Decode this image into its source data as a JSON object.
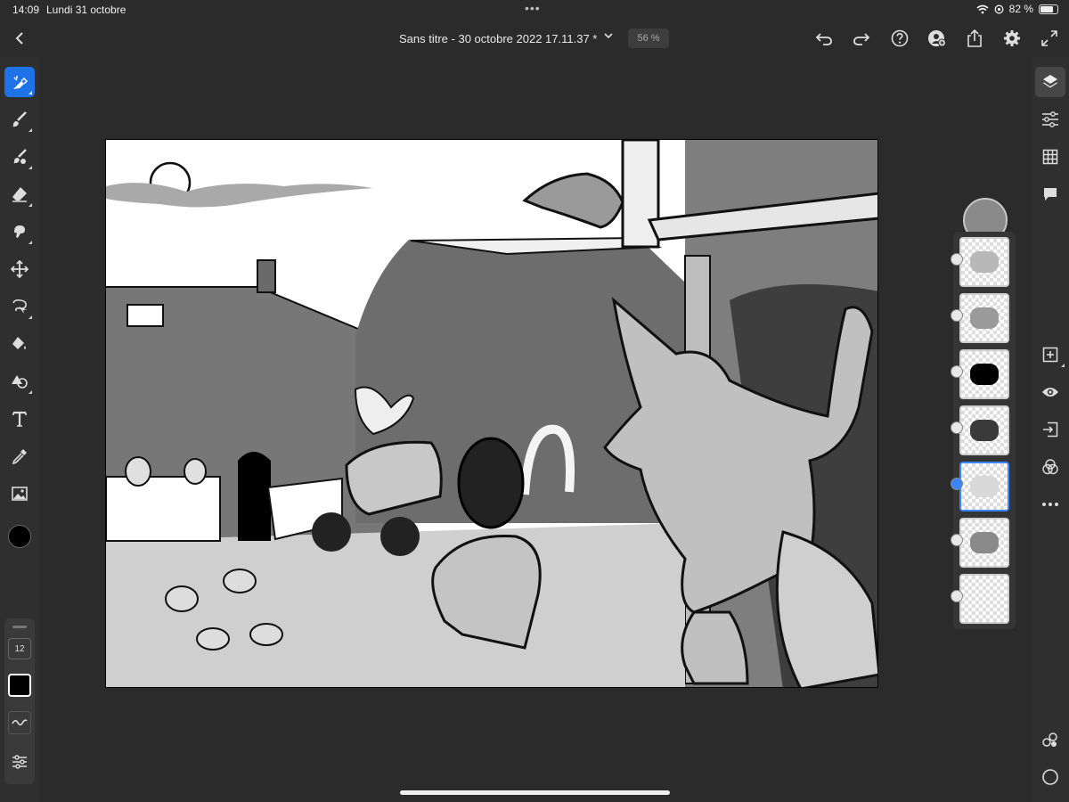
{
  "status_bar": {
    "time": "14:09",
    "date": "Lundi 31 octobre",
    "battery": "82 %",
    "battery_level": 0.82
  },
  "header": {
    "back_icon": "chevron-left-icon",
    "title": "Sans titre - 30 octobre 2022 17.11.37 *",
    "zoom": "56 %",
    "icons": [
      "undo-icon",
      "redo-icon",
      "help-icon",
      "add-user-icon",
      "share-icon",
      "settings-icon",
      "fullscreen-icon"
    ]
  },
  "left_toolbar": {
    "tools": [
      "touch-modifier-icon",
      "brush-icon",
      "mixer-brush-icon",
      "eraser-icon",
      "smudge-icon",
      "move-icon",
      "lasso-icon",
      "fill-icon",
      "shape-icon",
      "text-icon",
      "eyedropper-icon",
      "image-icon"
    ],
    "active_tool": "touch-modifier-icon",
    "current_color": "#000000",
    "brush_size": "12"
  },
  "right_toolbar": {
    "icons": [
      "layers-icon",
      "adjustments-icon",
      "grid-icon",
      "comment-icon",
      "add-layer-icon",
      "visibility-icon",
      "import-icon",
      "blend-icon",
      "more-icon",
      "cloud-icon",
      "circle-icon"
    ]
  },
  "layers": {
    "count": 7,
    "selected_index": 4
  },
  "colors": {
    "accent": "#1f73e8",
    "background": "#2b2b2b",
    "panel": "#353535"
  }
}
